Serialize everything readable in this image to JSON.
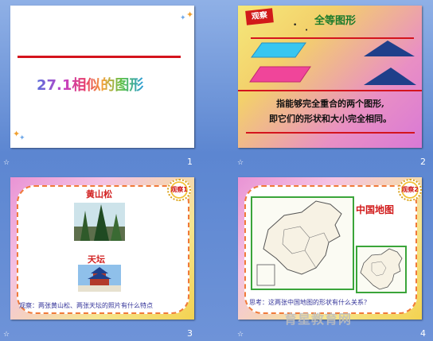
{
  "slides": [
    {
      "number": "1",
      "title": "27.1相似的图形"
    },
    {
      "number": "2",
      "tag": "观察",
      "heading": "全等图形",
      "body_line1": "指能够完全重合的两个图形,",
      "body_line2": "即它们的形状和大小完全相同。",
      "colors": {
        "parallelogram_top": "#38c6f0",
        "parallelogram_bottom": "#f0459a",
        "triangle": "#1f3f8a",
        "line": "#d4141d"
      }
    },
    {
      "number": "3",
      "badge": "观察1",
      "label_top": "黄山松",
      "label_bottom": "天坛",
      "caption": "观察：两张黄山松、两张天坛的照片有什么特点"
    },
    {
      "number": "4",
      "badge": "观察2",
      "map_title": "中国地图",
      "caption": "思考：这两张中国地图的形状有什么关系？"
    }
  ],
  "slide_icon": "star-transition-icon",
  "watermark": "育星教育网"
}
